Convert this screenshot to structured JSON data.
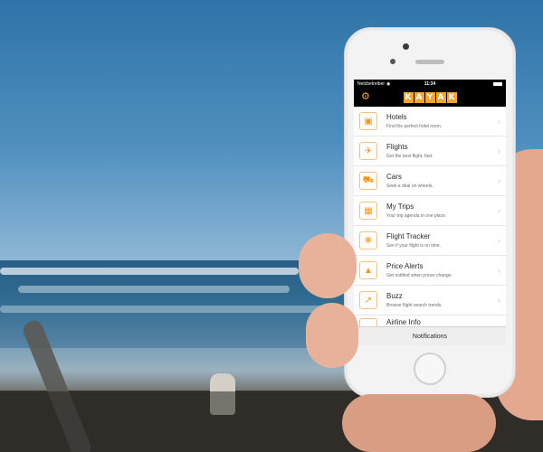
{
  "status_bar": {
    "carrier": "Netzbetreiber",
    "time": "11:34"
  },
  "app": {
    "logo_letters": [
      "K",
      "A",
      "Y",
      "A",
      "K"
    ],
    "accent_color": "#f7a42a"
  },
  "menu": {
    "items": [
      {
        "title": "Hotels",
        "subtitle": "Find the perfect hotel room.",
        "icon": "bed-icon"
      },
      {
        "title": "Flights",
        "subtitle": "Get the best flight, fast.",
        "icon": "airplane-icon"
      },
      {
        "title": "Cars",
        "subtitle": "Seek a deal on wheels.",
        "icon": "car-icon"
      },
      {
        "title": "My Trips",
        "subtitle": "Your trip agenda in one place.",
        "icon": "briefcase-icon"
      },
      {
        "title": "Flight Tracker",
        "subtitle": "See if your flight is on time.",
        "icon": "radar-icon"
      },
      {
        "title": "Price Alerts",
        "subtitle": "Get notified when prices change.",
        "icon": "bell-icon"
      },
      {
        "title": "Buzz",
        "subtitle": "Browse flight search trends.",
        "icon": "trend-icon"
      },
      {
        "title": "Airline Info",
        "subtitle": "",
        "icon": "info-icon"
      }
    ]
  },
  "bottom_bar": {
    "label": "Notifications"
  }
}
